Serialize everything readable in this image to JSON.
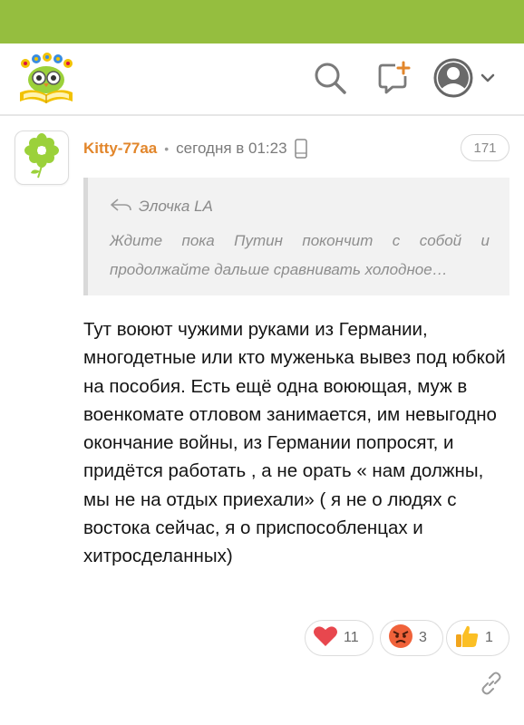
{
  "header": {
    "logo_icon": "owl-on-book-logo",
    "search_icon": "search-icon",
    "new_post_icon": "new-comment-plus-icon",
    "profile_icon": "user-avatar-icon",
    "colors": {
      "topbar": "#95be3f",
      "accent": "#e2862b"
    }
  },
  "comment": {
    "avatar_icon": "green-flower-avatar",
    "author": "Kitty-77aa",
    "separator": "•",
    "time": "сегодня в 01:23",
    "device_icon": "mobile-phone-icon",
    "number": "171",
    "quote": {
      "author": "Элочка LA",
      "line1": "Ждите пока Путин покончит с собой и",
      "line2": "продолжайте дальше сравнивать холодное…"
    },
    "body": "Тут воюют чужими руками из Германии, многодетные или кто муженька вывез под юбкой на пособия. Есть ещё одна воюющая, муж в военкомате отловом занимается, им невыгодно окончание войны, из Германии попросят, и придётся работать , а не орать « нам должны, мы не на отдых приехали» ( я не о людях с востока сейчас, я о приспособленцах и хитросделанных)",
    "reactions": [
      {
        "icon": "heart-icon",
        "count": "11"
      },
      {
        "icon": "angry-face-icon",
        "count": "3"
      },
      {
        "icon": "thumbs-up-icon",
        "count": "1"
      }
    ],
    "link_icon": "link-icon"
  }
}
